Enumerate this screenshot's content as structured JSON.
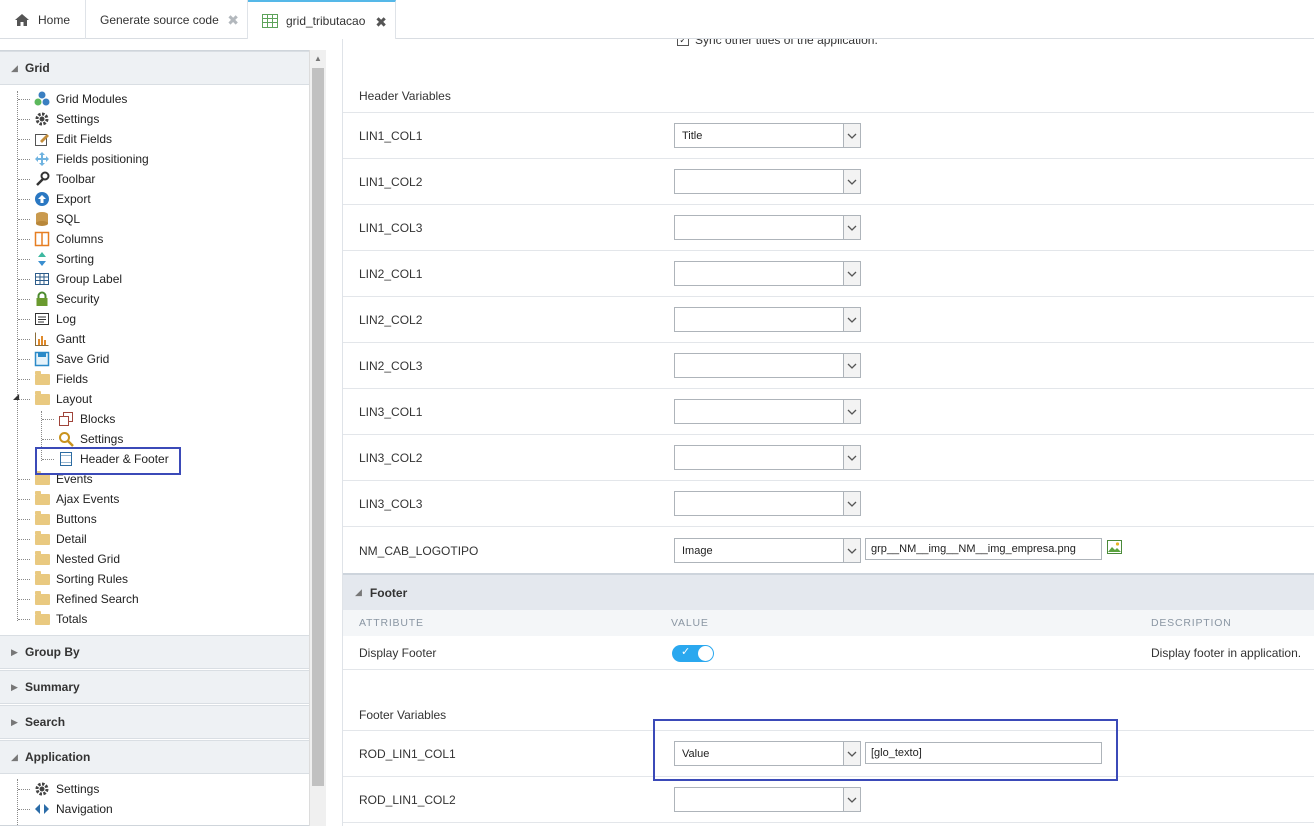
{
  "tabs": [
    {
      "label": "Home",
      "icon": "home-icon"
    },
    {
      "label": "Generate source code",
      "icon": ""
    },
    {
      "label": "grid_tributacao",
      "icon": "grid-table-icon"
    }
  ],
  "sidebar": {
    "sections": {
      "grid": "Grid",
      "group_by": "Group By",
      "summary": "Summary",
      "search": "Search",
      "application": "Application"
    },
    "grid_items": [
      {
        "label": "Grid Modules",
        "icon": "modules-icon"
      },
      {
        "label": "Settings",
        "icon": "gear-icon"
      },
      {
        "label": "Edit Fields",
        "icon": "edit-fields-icon"
      },
      {
        "label": "Fields positioning",
        "icon": "move-arrows-icon"
      },
      {
        "label": "Toolbar",
        "icon": "wrench-icon"
      },
      {
        "label": "Export",
        "icon": "export-icon"
      },
      {
        "label": "SQL",
        "icon": "database-icon"
      },
      {
        "label": "Columns",
        "icon": "columns-icon"
      },
      {
        "label": "Sorting",
        "icon": "sort-arrows-icon"
      },
      {
        "label": "Group Label",
        "icon": "table-icon"
      },
      {
        "label": "Security",
        "icon": "lock-icon"
      },
      {
        "label": "Log",
        "icon": "log-icon"
      },
      {
        "label": "Gantt",
        "icon": "gantt-chart-icon"
      },
      {
        "label": "Save Grid",
        "icon": "save-icon"
      },
      {
        "label": "Fields",
        "icon": "folder-icon"
      },
      {
        "label": "Layout",
        "icon": "folder-icon"
      }
    ],
    "layout_items": [
      {
        "label": "Blocks",
        "icon": "blocks-icon"
      },
      {
        "label": "Settings",
        "icon": "magnifier-icon"
      },
      {
        "label": "Header & Footer",
        "icon": "header-footer-icon"
      }
    ],
    "folder_items": [
      "Events",
      "Ajax Events",
      "Buttons",
      "Detail",
      "Nested Grid",
      "Sorting Rules",
      "Refined Search",
      "Totals"
    ],
    "application_items": [
      {
        "label": "Settings",
        "icon": "gear-icon"
      },
      {
        "label": "Navigation",
        "icon": "navigation-icon"
      }
    ]
  },
  "main": {
    "sync_text": "Sync other titles of the application.",
    "header_variables_title": "Header Variables",
    "header_rows": [
      {
        "label": "LIN1_COL1",
        "value": "Title"
      },
      {
        "label": "LIN1_COL2",
        "value": ""
      },
      {
        "label": "LIN1_COL3",
        "value": ""
      },
      {
        "label": "LIN2_COL1",
        "value": ""
      },
      {
        "label": "LIN2_COL2",
        "value": ""
      },
      {
        "label": "LIN2_COL3",
        "value": ""
      },
      {
        "label": "LIN3_COL1",
        "value": ""
      },
      {
        "label": "LIN3_COL2",
        "value": ""
      },
      {
        "label": "LIN3_COL3",
        "value": ""
      }
    ],
    "logo_row": {
      "label": "NM_CAB_LOGOTIPO",
      "value": "Image",
      "text": "grp__NM__img__NM__img_empresa.png"
    },
    "footer": {
      "title": "Footer",
      "col_attribute": "ATTRIBUTE",
      "col_value": "VALUE",
      "col_description": "DESCRIPTION",
      "display_label": "Display Footer",
      "display_on": true,
      "display_desc": "Display footer in application.",
      "variables_title": "Footer Variables",
      "rows": [
        {
          "label": "ROD_LIN1_COL1",
          "value": "Value",
          "text": "[glo_texto]"
        },
        {
          "label": "ROD_LIN1_COL2",
          "value": "",
          "text": ""
        }
      ]
    }
  },
  "colors": {
    "accent": "#2aa8ef",
    "highlight": "#3b4ab8"
  }
}
